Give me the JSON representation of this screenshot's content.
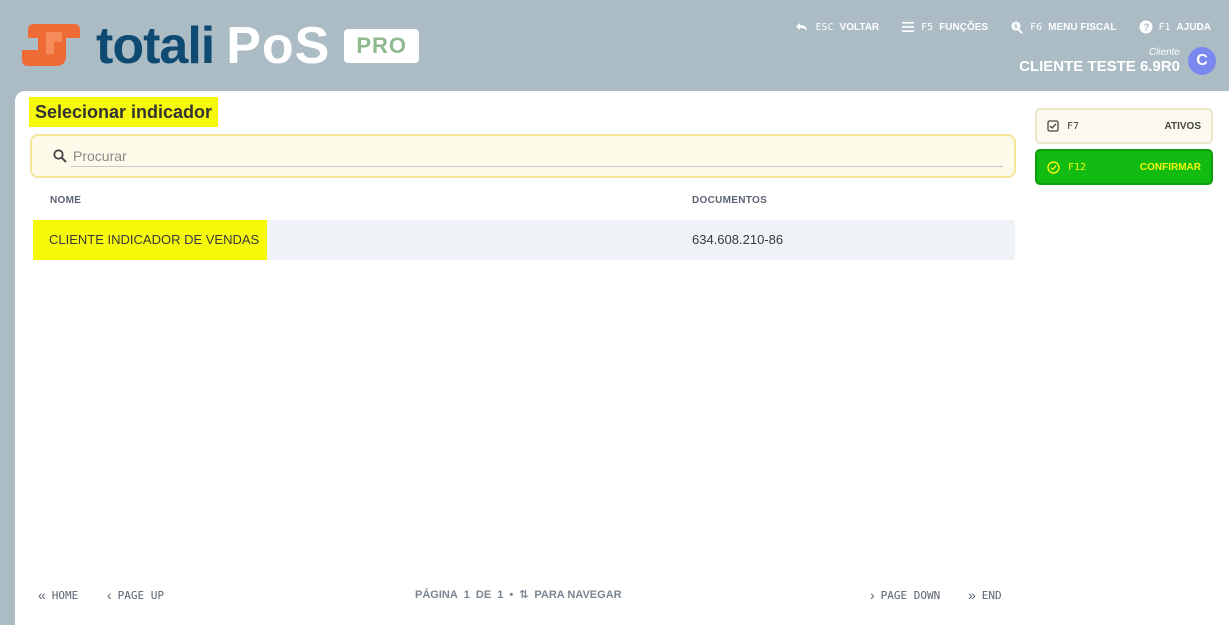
{
  "brand": {
    "word": "totali",
    "product": "PoS",
    "edition": "PRO"
  },
  "topnav": [
    {
      "icon": "undo-icon",
      "key": "ESC",
      "label": "VOLTAR"
    },
    {
      "icon": "menu-icon",
      "key": "F5",
      "label": "FUNÇÕES"
    },
    {
      "icon": "fiscal-search-icon",
      "key": "F6",
      "label": "MENU FISCAL"
    },
    {
      "icon": "help-icon",
      "key": "F1",
      "label": "AJUDA"
    }
  ],
  "client": {
    "caption": "Cliente",
    "name": "CLIENTE TESTE 6.9R0",
    "avatar": "C"
  },
  "page": {
    "title": "Selecionar indicador",
    "search_placeholder": "Procurar",
    "search_value": ""
  },
  "table": {
    "headers": {
      "nome": "NOME",
      "documentos": "DOCUMENTOS"
    },
    "rows": [
      {
        "nome": "CLIENTE INDICADOR DE VENDAS",
        "documentos": "634.608.210-86"
      }
    ]
  },
  "footer": {
    "home": "HOME",
    "page_up": "PAGE UP",
    "pagina_label": "PÁGINA",
    "current": "1",
    "de_label": "DE",
    "total": "1",
    "nav_label": "PARA NAVEGAR",
    "page_down": "PAGE DOWN",
    "end": "END"
  },
  "side": {
    "ativos": {
      "key": "F7",
      "label": "ATIVOS"
    },
    "confirmar": {
      "key": "F12",
      "label": "CONFIRMAR"
    }
  },
  "colors": {
    "header_bg": "#abbcc4",
    "highlight": "#f6f90a",
    "confirm_green": "#12bb12",
    "brand_blue": "#0f4a73",
    "brand_orange": "#f06a35"
  }
}
